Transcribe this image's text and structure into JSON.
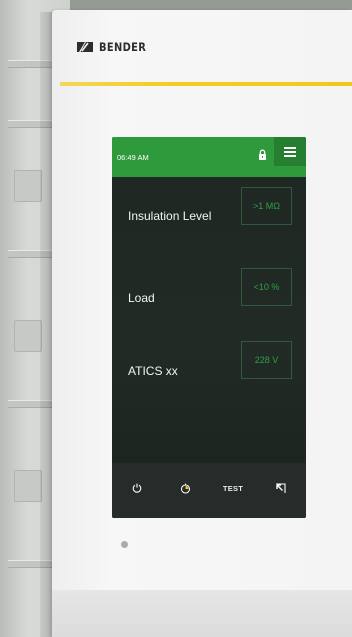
{
  "device": {
    "brand": "BENDER",
    "accent_color": "#f3c81c"
  },
  "status_bar": {
    "time": "06:49 AM",
    "lock_icon": "lock-icon",
    "menu_icon": "hamburger-menu-icon",
    "color": "#2f9a3c"
  },
  "readings": [
    {
      "label": "Insulation Level",
      "value": ">1 MΩ"
    },
    {
      "label": "Load",
      "value": "<10 %"
    },
    {
      "label": "ATICS xx",
      "value": "228 V"
    }
  ],
  "value_color": "#2ea044",
  "nav": {
    "items": [
      {
        "icon": "power-icon"
      },
      {
        "icon": "timer-icon"
      },
      {
        "label": "TEST"
      },
      {
        "icon": "exit-icon"
      }
    ]
  }
}
